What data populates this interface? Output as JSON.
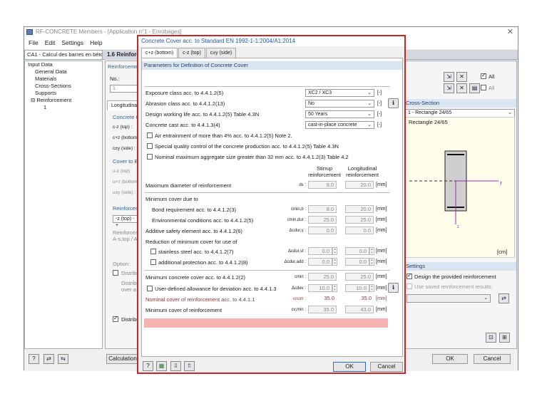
{
  "main": {
    "title": "RF-CONCRETE Members - [Application n°1 - Enrobages]",
    "menu": [
      "File",
      "Edit",
      "Settings",
      "Help"
    ],
    "case_select": "CA1 - Calcul des barres en béto",
    "section_title": "1.6 Reinforce",
    "tree": {
      "root": "Input Data",
      "items": [
        "General Data",
        "Materials",
        "Cross-Sections",
        "Supports",
        "Reinforcement"
      ],
      "leaf": "1"
    },
    "mid": {
      "reinforcement": "Reinforceme",
      "no_label": "No.:",
      "no_value": "1",
      "long_tab": "Longitudinal",
      "concrete_label": "Concrete C",
      "c_top": "c-z (top) :",
      "c_bottom": "c+z (bottom) :",
      "c_side": "c±y (side) :",
      "cover_label": "Cover to Ba",
      "u_top": "u-z (top) :",
      "u_bottom": "u+z (bottom) :",
      "u_side": "u±y (side) :",
      "reinf2": "Reinforceme",
      "combo": "-z (top) - +",
      "reinf_a": "Reinforceme",
      "reinf_a2": "A-s,top / A",
      "option": "Option:",
      "distrib1": "Distribu",
      "distrib2": "Distribu",
      "distrib3": "over a w",
      "distrib4": "Distribu"
    },
    "right": {
      "all1": "All",
      "all2": "All",
      "cross_section": "Cross-Section",
      "cs_select": "1 - Rectangle 24/65",
      "cs_title": "Rectangle 24/65",
      "unit": "[cm]",
      "settings": "Settings",
      "design_provided": "Design the provided reinforcement",
      "use_saved": "Use saved reinforcement results:"
    },
    "bottom": {
      "calc": "Calculation",
      "ok": "OK",
      "cancel": "Cancel"
    },
    "colors": {
      "accent": "#c62828",
      "header_blue": "#d9e6f2"
    }
  },
  "dialog": {
    "title": "Concrete Cover acc. to Standard EN 1992-1-1:2004/A1:2014",
    "tabs": [
      "c+z (bottom)",
      "c-z (top)",
      "c±y (side)"
    ],
    "params_header": "Parameters for Definition of Concrete Cover",
    "exposure": {
      "label": "Exposure class acc. to 4.4.1.2(5)",
      "value": "XC2 / XC3",
      "unit": "[-]"
    },
    "abrasion": {
      "label": "Abrasion class acc. to 4.4.1.2(13)",
      "value": "No",
      "unit": "[-]"
    },
    "life": {
      "label": "Design working life acc. to 4.4.1.2(5) Table 4.3N",
      "value": "50 Years",
      "unit": "[-]"
    },
    "cast": {
      "label": "Concrete cast acc. to 4.4.1.3(4)",
      "value": "cast-in-place concrete",
      "unit": "[-]"
    },
    "checks": [
      "Air entrainment of more than 4% acc. to 4.4.1.2(5) Note 2.",
      "Special quality control of the concrete production acc. to 4.4.1.2(5) Table 4.3N",
      "Nominal maximum aggregate size greater than 32 mm acc. to  4.4.1.2(3) Table 4.2"
    ],
    "col_stirrup": "Stirrup",
    "col_stirrup2": "reinforcement",
    "col_long": "Longitudinal",
    "col_long2": "reinforcement",
    "max_diam": {
      "label": "Maximum diameter of reinforcement",
      "sym": "ds :",
      "v1": "8.0",
      "v2": "20.0",
      "unit": "[mm]"
    },
    "min_cover_due": "Minimum cover due to",
    "bond": {
      "label": "Bond requirement acc. to 4.4.1.2(3)",
      "sym": "cmin,b :",
      "v1": "8.0",
      "v2": "20.0",
      "unit": "[mm]"
    },
    "env": {
      "label": "Environmental conditions acc. to 4.4.1.2(5)",
      "sym": "cmin,dur :",
      "v1": "25.0",
      "v2": "25.0",
      "unit": "[mm]"
    },
    "additive": {
      "label": "Additive safety element acc. to 4.4.1.2(6)",
      "sym": "Δcdur,γ :",
      "v1": "0.0",
      "v2": "0.0",
      "unit": "[mm]"
    },
    "reduction": "Reduction of minimum cover for use of",
    "stainless": {
      "label": "stainless steel acc. to 4.4.1.2(7)",
      "sym": "Δcdur,st :",
      "v1": "0.0",
      "v2": "0.0",
      "unit": "[mm]"
    },
    "addprot": {
      "label": "additional protection acc. to 4.4.1.2(8)",
      "sym": "Δcdur,add :",
      "v1": "0.0",
      "v2": "0.0",
      "unit": "[mm]"
    },
    "mincover": {
      "label": "Minimum concrete cover acc. to 4.4.1.2(2)",
      "sym": "cmin :",
      "v1": "25.0",
      "v2": "25.0",
      "unit": "[mm]"
    },
    "userdef": {
      "label": "User-defined allowance for deviation acc. to 4.4.1.3",
      "sym": "Δcdev :",
      "v1": "10.0",
      "v2": "10.0",
      "unit": "[mm]"
    },
    "nominal": {
      "label": "Nominal cover of reinforcement acc. to 4.4.1.1",
      "sym": "cnom :",
      "v1": "35.0",
      "v2": "35.0",
      "unit": "[mm]"
    },
    "mincover_reinf": {
      "label": "Minimum cover of reinforcement",
      "sym": "cv,min :",
      "v1": "35.0",
      "v2": "43.0",
      "unit": "[mm]"
    },
    "ok": "OK",
    "cancel": "Cancel"
  }
}
